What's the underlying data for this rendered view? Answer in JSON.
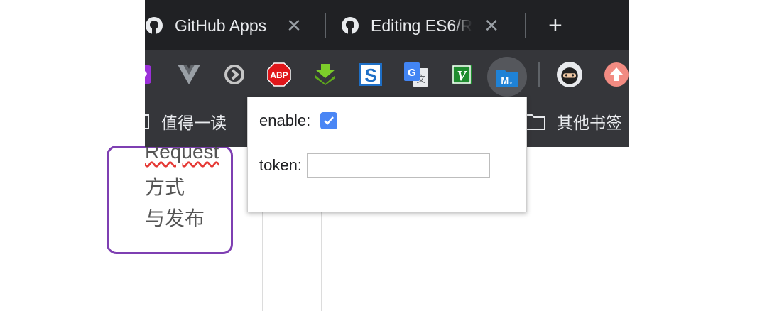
{
  "tabs": [
    {
      "title": "GitHub Apps",
      "close": "✕",
      "icon": "github-icon"
    },
    {
      "title": "Editing ES6/R",
      "close": "✕",
      "icon": "github-icon"
    }
  ],
  "new_tab": "+",
  "extensions": [
    {
      "name": "ext-purple-icon"
    },
    {
      "name": "vue-devtools-icon"
    },
    {
      "name": "play-circle-icon"
    },
    {
      "name": "adblock-plus-icon",
      "text": "ABP"
    },
    {
      "name": "download-arrow-icon"
    },
    {
      "name": "s-extension-icon",
      "text": "S"
    },
    {
      "name": "google-translate-icon",
      "text": "G"
    },
    {
      "name": "v-extension-icon",
      "text": "V"
    },
    {
      "name": "markdown-folder-icon",
      "text": "M↓"
    },
    {
      "name": "ninja-avatar-icon"
    },
    {
      "name": "upload-arrow-icon"
    }
  ],
  "bookmarks": {
    "left": "值得一读",
    "right": "其他书签"
  },
  "page": {
    "line1": "Request",
    "line2": "方式",
    "line3": "与发布"
  },
  "popup": {
    "enable_label": "enable:",
    "enabled": true,
    "token_label": "token:",
    "token_value": "",
    "token_placeholder": ""
  },
  "colors": {
    "tab_bar": "#202124",
    "toolbar": "#35363a",
    "checkbox_accent": "#4a86f5",
    "card_border": "#7e3fb2"
  }
}
